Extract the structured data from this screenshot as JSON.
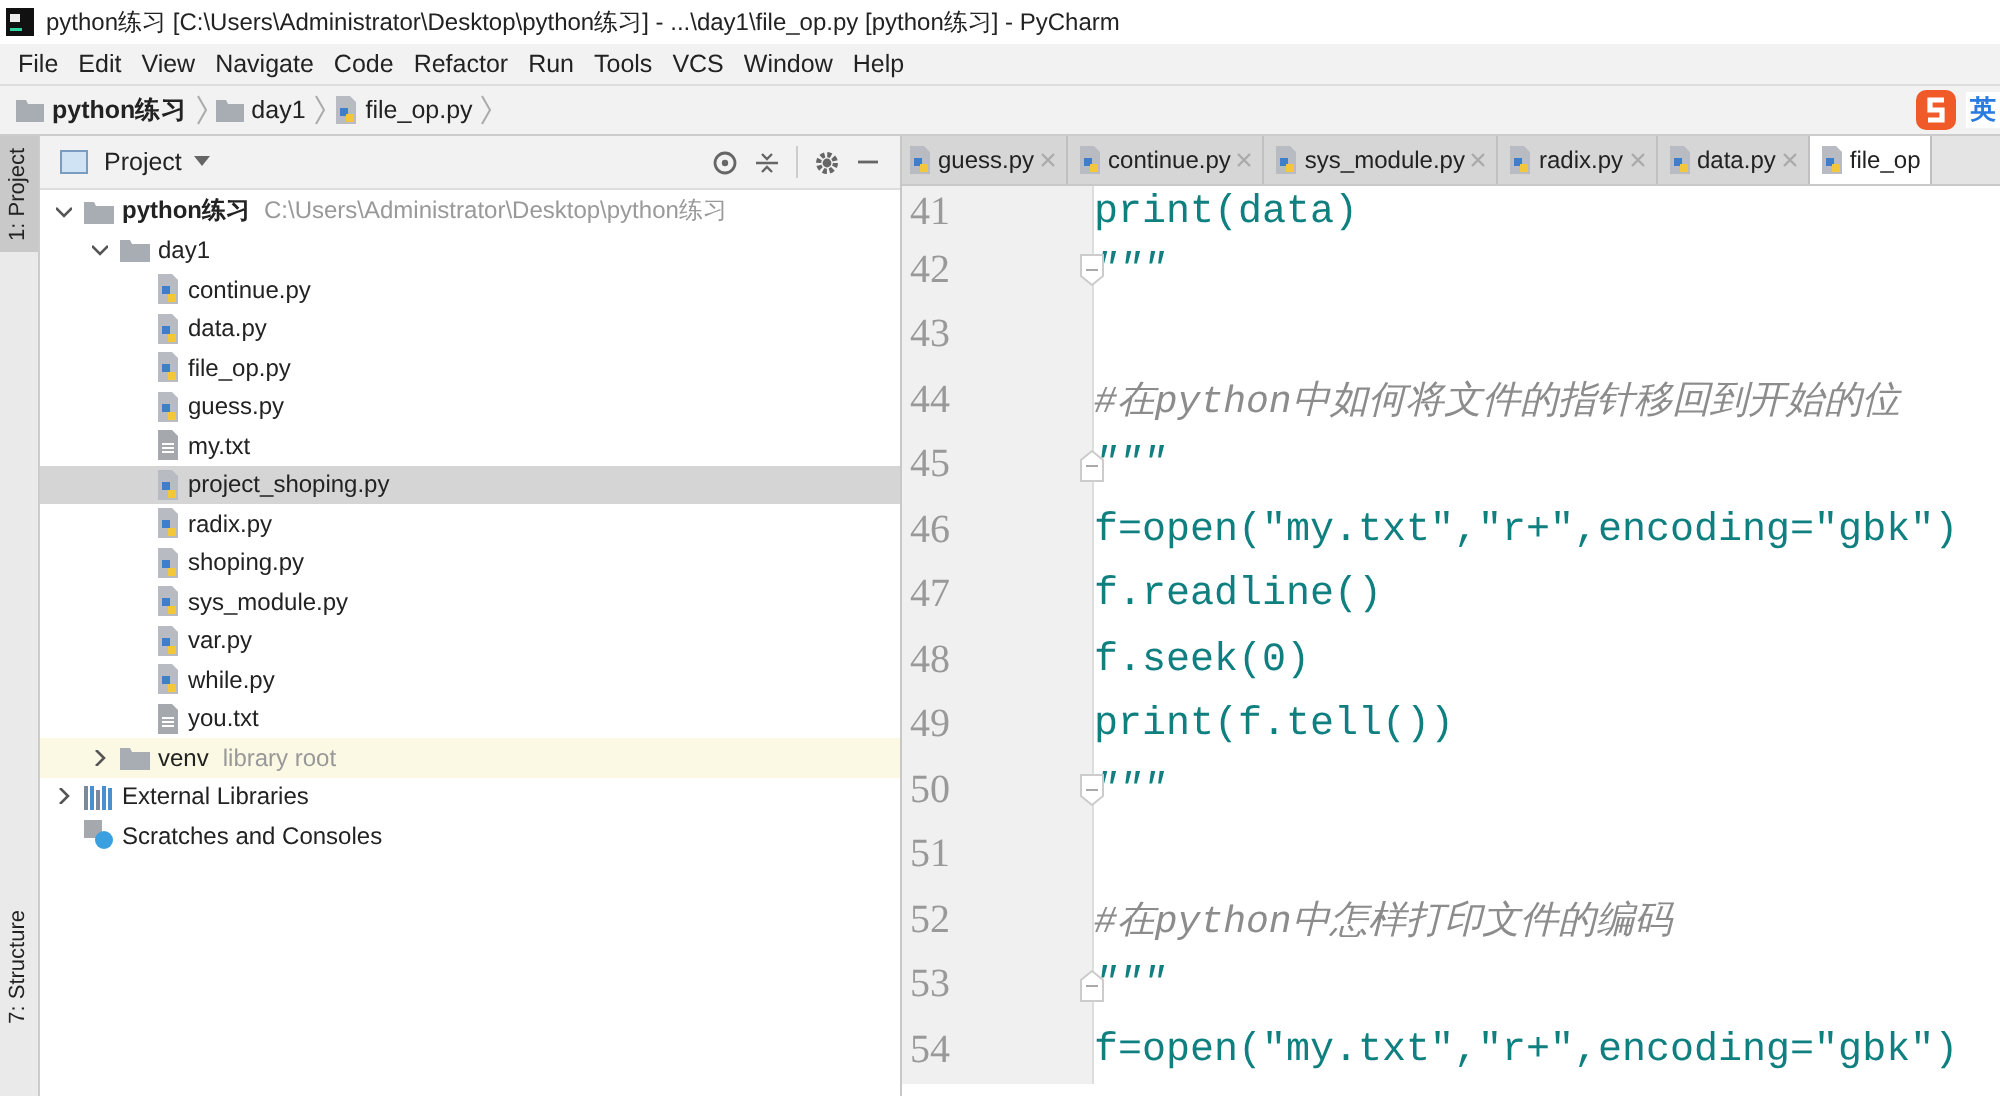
{
  "window": {
    "title": "python练习 [C:\\Users\\Administrator\\Desktop\\python练习] - ...\\day1\\file_op.py [python练习] - PyCharm"
  },
  "menu": [
    "File",
    "Edit",
    "View",
    "Navigate",
    "Code",
    "Refactor",
    "Run",
    "Tools",
    "VCS",
    "Window",
    "Help"
  ],
  "breadcrumb": [
    {
      "label": "python练习",
      "kind": "folder"
    },
    {
      "label": "day1",
      "kind": "folder"
    },
    {
      "label": "file_op.py",
      "kind": "python"
    }
  ],
  "ime": {
    "label": "英"
  },
  "side_tabs": [
    {
      "label": "1: Project",
      "selected": true
    },
    {
      "label": "7: Structure",
      "selected": false
    }
  ],
  "project_panel": {
    "title": "Project",
    "tree": [
      {
        "label": "python练习",
        "kind": "folder",
        "path": "C:\\Users\\Administrator\\Desktop\\python练习",
        "expanded": true,
        "selected": false,
        "children": [
          {
            "label": "day1",
            "kind": "folder",
            "expanded": true,
            "selected": false,
            "children": [
              {
                "label": "continue.py",
                "kind": "python",
                "selected": false
              },
              {
                "label": "data.py",
                "kind": "python",
                "selected": false
              },
              {
                "label": "file_op.py",
                "kind": "python",
                "selected": false
              },
              {
                "label": "guess.py",
                "kind": "python",
                "selected": false
              },
              {
                "label": "my.txt",
                "kind": "text",
                "selected": false
              },
              {
                "label": "project_shoping.py",
                "kind": "python",
                "selected": true
              },
              {
                "label": "radix.py",
                "kind": "python",
                "selected": false
              },
              {
                "label": "shoping.py",
                "kind": "python",
                "selected": false
              },
              {
                "label": "sys_module.py",
                "kind": "python",
                "selected": false
              },
              {
                "label": "var.py",
                "kind": "python",
                "selected": false
              },
              {
                "label": "while.py",
                "kind": "python",
                "selected": false
              },
              {
                "label": "you.txt",
                "kind": "text",
                "selected": false
              }
            ]
          },
          {
            "label": "venv",
            "kind": "library",
            "note": "library root",
            "expanded": false,
            "selected": false
          }
        ]
      },
      {
        "label": "External Libraries",
        "kind": "libraries",
        "expanded": false,
        "selected": false
      },
      {
        "label": "Scratches and Consoles",
        "kind": "scratches",
        "selected": false
      }
    ]
  },
  "editor_tabs": [
    {
      "label": "guess.py",
      "selected": false
    },
    {
      "label": "continue.py",
      "selected": false
    },
    {
      "label": "sys_module.py",
      "selected": false
    },
    {
      "label": "radix.py",
      "selected": false
    },
    {
      "label": "data.py",
      "selected": false
    },
    {
      "label": "file_op",
      "selected": true
    }
  ],
  "code_lines": [
    {
      "number": "41",
      "text": "print(data)",
      "kind": "code",
      "fold": false
    },
    {
      "number": "42",
      "text": "\"\"\"",
      "kind": "doc",
      "fold": true
    },
    {
      "number": "43",
      "kind": "blank",
      "fold": false
    },
    {
      "number": "44",
      "text": "#在python中如何将文件的指针移回到开始的位",
      "kind": "comment",
      "fold": false
    },
    {
      "number": "45",
      "text": "\"\"\"",
      "kind": "doc",
      "fold": true
    },
    {
      "number": "46",
      "text": "f=open(\"my.txt\",\"r+\",encoding=\"gbk\")",
      "kind": "code",
      "fold": false
    },
    {
      "number": "47",
      "text": "f.readline()",
      "kind": "code",
      "fold": false
    },
    {
      "number": "48",
      "text": "f.seek(0)",
      "kind": "code",
      "fold": false
    },
    {
      "number": "49",
      "text": "print(f.tell())",
      "kind": "code",
      "fold": false
    },
    {
      "number": "50",
      "text": "\"\"\"",
      "kind": "doc",
      "fold": true
    },
    {
      "number": "51",
      "kind": "blank",
      "fold": false
    },
    {
      "number": "52",
      "text": "#在python中怎样打印文件的编码",
      "kind": "comment",
      "fold": false
    },
    {
      "number": "53",
      "text": "\"\"\"",
      "kind": "doc",
      "fold": true
    },
    {
      "number": "54",
      "text": "f=open(\"my.txt\",\"r+\",encoding=\"gbk\")",
      "kind": "code",
      "fold": false
    }
  ]
}
